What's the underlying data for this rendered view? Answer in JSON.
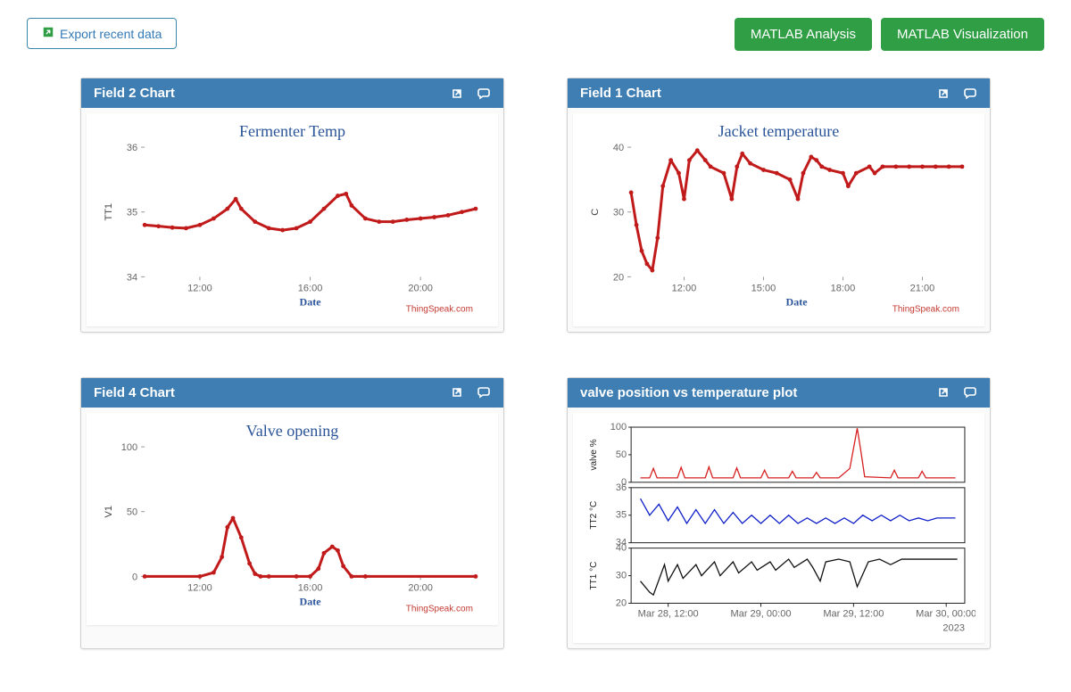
{
  "toolbar": {
    "export_label": "Export recent data",
    "analysis_label": "MATLAB Analysis",
    "visualization_label": "MATLAB Visualization"
  },
  "panels": {
    "field2": {
      "header": "Field 2 Chart"
    },
    "field1": {
      "header": "Field 1 Chart"
    },
    "field4": {
      "header": "Field 4 Chart"
    },
    "multi": {
      "header": "valve position vs temperature plot"
    }
  },
  "watermark": "ThingSpeak.com",
  "chart_data": [
    {
      "id": "field2",
      "type": "line",
      "title": "Fermenter Temp",
      "xlabel": "Date",
      "ylabel": "TT1",
      "ylim": [
        34,
        36
      ],
      "yticks": [
        34,
        35,
        36
      ],
      "xticks": [
        "12:00",
        "16:00",
        "20:00"
      ],
      "color": "#c11a1a",
      "watermark": "ThingSpeak.com",
      "series": [
        {
          "name": "TT1",
          "x": [
            10.0,
            10.5,
            11.0,
            11.5,
            12.0,
            12.5,
            13.0,
            13.3,
            13.5,
            14.0,
            14.5,
            15.0,
            15.5,
            16.0,
            16.5,
            17.0,
            17.3,
            17.5,
            18.0,
            18.5,
            19.0,
            19.5,
            20.0,
            20.5,
            21.0,
            21.5,
            22.0
          ],
          "values": [
            34.8,
            34.78,
            34.76,
            34.75,
            34.8,
            34.9,
            35.05,
            35.2,
            35.05,
            34.85,
            34.75,
            34.72,
            34.75,
            34.85,
            35.05,
            35.25,
            35.28,
            35.1,
            34.9,
            34.85,
            34.85,
            34.88,
            34.9,
            34.92,
            34.95,
            35.0,
            35.05
          ]
        }
      ]
    },
    {
      "id": "field1",
      "type": "line",
      "title": "Jacket temperature",
      "xlabel": "Date",
      "ylabel": "C",
      "ylim": [
        20,
        40
      ],
      "yticks": [
        20,
        30,
        40
      ],
      "xticks": [
        "12:00",
        "15:00",
        "18:00",
        "21:00"
      ],
      "color": "#c11a1a",
      "watermark": "ThingSpeak.com",
      "series": [
        {
          "name": "C",
          "x": [
            10.0,
            10.2,
            10.4,
            10.6,
            10.8,
            11.0,
            11.2,
            11.5,
            11.8,
            12.0,
            12.2,
            12.5,
            12.8,
            13.0,
            13.5,
            13.8,
            14.0,
            14.2,
            14.5,
            15.0,
            15.5,
            16.0,
            16.3,
            16.5,
            16.8,
            17.0,
            17.2,
            17.5,
            18.0,
            18.2,
            18.5,
            19.0,
            19.2,
            19.5,
            20.0,
            20.5,
            21.0,
            21.5,
            22.0,
            22.5
          ],
          "values": [
            33,
            28,
            24,
            22,
            21,
            26,
            34,
            38,
            36,
            32,
            38,
            39.5,
            38,
            37,
            36,
            32,
            37,
            39,
            37.5,
            36.5,
            36,
            35,
            32,
            36,
            38.5,
            38,
            37,
            36.5,
            36,
            34,
            36,
            37,
            36,
            37,
            37,
            37,
            37,
            37,
            37,
            37
          ]
        }
      ]
    },
    {
      "id": "field4",
      "type": "line",
      "title": "Valve opening",
      "xlabel": "Date",
      "ylabel": "V1",
      "ylim": [
        0,
        100
      ],
      "yticks": [
        0,
        50,
        100
      ],
      "xticks": [
        "12:00",
        "16:00",
        "20:00"
      ],
      "color": "#c11a1a",
      "watermark": "ThingSpeak.com",
      "series": [
        {
          "name": "V1",
          "x": [
            10.0,
            12.0,
            12.5,
            12.8,
            13.0,
            13.2,
            13.5,
            13.8,
            14.0,
            14.2,
            14.5,
            15.5,
            16.0,
            16.3,
            16.5,
            16.8,
            17.0,
            17.2,
            17.5,
            18.0,
            22.0
          ],
          "values": [
            0,
            0,
            3,
            15,
            38,
            45,
            30,
            10,
            2,
            0,
            0,
            0,
            0,
            6,
            18,
            23,
            20,
            8,
            0,
            0,
            0
          ]
        }
      ]
    },
    {
      "id": "multi",
      "type": "line",
      "xlabel": "",
      "xticks_text": [
        "Mar 28, 12:00",
        "Mar 29, 00:00",
        "Mar 29, 12:00",
        "Mar 30, 00:00"
      ],
      "xticks_pos": [
        28.5,
        29.0,
        29.5,
        30.0
      ],
      "xrange": [
        28.3,
        30.1
      ],
      "year_label": "2023",
      "subplots": [
        {
          "ylabel": "valve %",
          "color": "#d62020",
          "ylim": [
            0,
            100
          ],
          "yticks": [
            0,
            50,
            100
          ],
          "x": [
            28.35,
            28.4,
            28.42,
            28.44,
            28.55,
            28.57,
            28.59,
            28.7,
            28.72,
            28.74,
            28.85,
            28.87,
            28.89,
            29.0,
            29.02,
            29.04,
            29.15,
            29.17,
            29.19,
            29.28,
            29.3,
            29.32,
            29.42,
            29.48,
            29.5,
            29.52,
            29.54,
            29.56,
            29.7,
            29.72,
            29.74,
            29.85,
            29.87,
            29.89,
            30.05
          ],
          "values": [
            8,
            8,
            25,
            8,
            8,
            27,
            8,
            8,
            28,
            8,
            8,
            26,
            8,
            8,
            22,
            8,
            8,
            20,
            8,
            8,
            18,
            8,
            8,
            25,
            62,
            98,
            55,
            10,
            8,
            22,
            8,
            8,
            20,
            8,
            8
          ]
        },
        {
          "ylabel": "TT2 °C",
          "color": "#1020c8",
          "ylim": [
            34,
            36
          ],
          "yticks": [
            34,
            35,
            36
          ],
          "x": [
            28.35,
            28.4,
            28.45,
            28.5,
            28.55,
            28.6,
            28.65,
            28.7,
            28.75,
            28.8,
            28.85,
            28.9,
            28.95,
            29.0,
            29.05,
            29.1,
            29.15,
            29.2,
            29.25,
            29.3,
            29.35,
            29.4,
            29.45,
            29.5,
            29.55,
            29.6,
            29.65,
            29.7,
            29.75,
            29.8,
            29.85,
            29.9,
            29.95,
            30.0,
            30.05
          ],
          "values": [
            35.6,
            35.0,
            35.4,
            34.8,
            35.3,
            34.7,
            35.2,
            34.7,
            35.2,
            34.7,
            35.1,
            34.7,
            35.0,
            34.7,
            35.0,
            34.7,
            35.0,
            34.7,
            34.9,
            34.7,
            34.9,
            34.7,
            34.9,
            34.7,
            35.0,
            34.8,
            35.0,
            34.8,
            35.0,
            34.8,
            34.9,
            34.8,
            34.9,
            34.9,
            34.9
          ]
        },
        {
          "ylabel": "TT1 °C",
          "color": "#111111",
          "ylim": [
            20,
            40
          ],
          "yticks": [
            20,
            30,
            40
          ],
          "x": [
            28.35,
            28.4,
            28.42,
            28.48,
            28.5,
            28.55,
            28.58,
            28.65,
            28.68,
            28.75,
            28.78,
            28.85,
            28.88,
            28.95,
            28.98,
            29.05,
            29.08,
            29.15,
            29.18,
            29.25,
            29.28,
            29.32,
            29.35,
            29.42,
            29.48,
            29.52,
            29.58,
            29.64,
            29.7,
            29.76,
            29.82,
            29.88,
            29.94,
            30.0,
            30.06
          ],
          "values": [
            28,
            24,
            23,
            34,
            28,
            34,
            29,
            34,
            30,
            35,
            30,
            35,
            31,
            35,
            32,
            35,
            32,
            36,
            33,
            36,
            33,
            28,
            35,
            36,
            35,
            26,
            35,
            36,
            34,
            36,
            36,
            36,
            36,
            36,
            36
          ]
        }
      ]
    }
  ]
}
